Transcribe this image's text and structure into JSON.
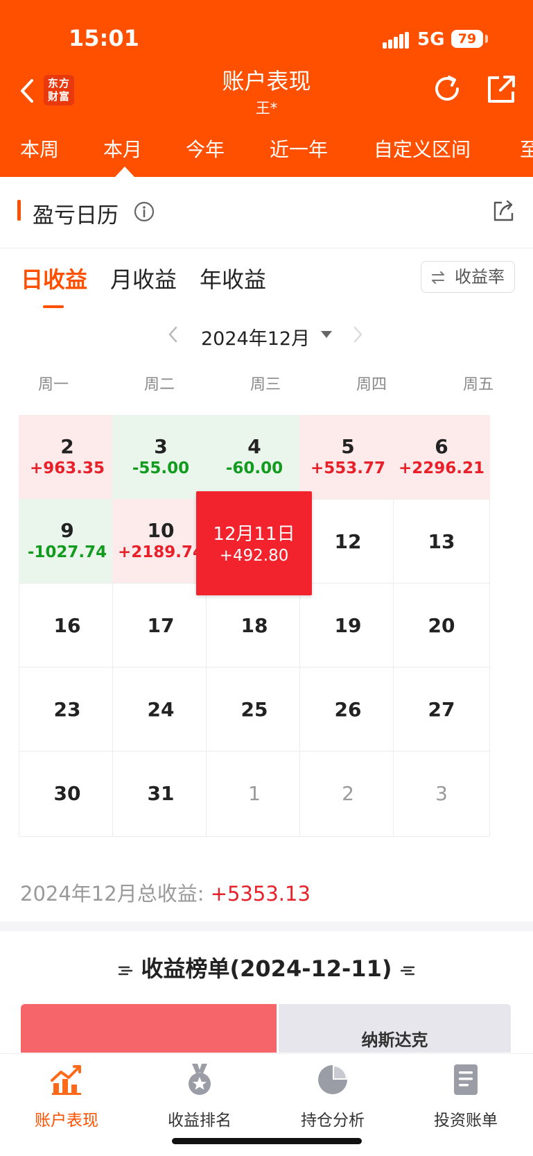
{
  "status_bar": {
    "time": "15:01",
    "network": "5G",
    "battery": "79"
  },
  "header": {
    "logo_line1": "东方",
    "logo_line2": "财富",
    "title": "账户表现",
    "subtitle": "王*"
  },
  "period_tabs": [
    "本周",
    "本月",
    "今年",
    "近一年",
    "自定义区间",
    "至"
  ],
  "period_active_index": 1,
  "calendar_section": {
    "title": "盈亏日历",
    "mode_tabs": [
      "日收益",
      "月收益",
      "年收益"
    ],
    "mode_active_index": 0,
    "rate_button": "收益率",
    "month_label": "2024年12月",
    "weekdays": [
      "周一",
      "周二",
      "周三",
      "周四",
      "周五"
    ],
    "rows": [
      [
        {
          "day": "2",
          "pnl": "+963.35",
          "status": "gain"
        },
        {
          "day": "3",
          "pnl": "-55.00",
          "status": "loss"
        },
        {
          "day": "4",
          "pnl": "-60.00",
          "status": "loss"
        },
        {
          "day": "5",
          "pnl": "+553.77",
          "status": "gain"
        },
        {
          "day": "6",
          "pnl": "+2296.21",
          "status": "gain"
        }
      ],
      [
        {
          "day": "9",
          "pnl": "-1027.74",
          "status": "loss"
        },
        {
          "day": "10",
          "pnl": "+2189.74",
          "status": "gain"
        },
        {
          "day": "12月11日",
          "pnl": "+492.80",
          "status": "selected"
        },
        {
          "day": "12",
          "pnl": "",
          "status": "plain"
        },
        {
          "day": "13",
          "pnl": "",
          "status": "plain"
        }
      ],
      [
        {
          "day": "16",
          "pnl": "",
          "status": "plain"
        },
        {
          "day": "17",
          "pnl": "",
          "status": "plain"
        },
        {
          "day": "18",
          "pnl": "",
          "status": "plain"
        },
        {
          "day": "19",
          "pnl": "",
          "status": "plain"
        },
        {
          "day": "20",
          "pnl": "",
          "status": "plain"
        }
      ],
      [
        {
          "day": "23",
          "pnl": "",
          "status": "plain"
        },
        {
          "day": "24",
          "pnl": "",
          "status": "plain"
        },
        {
          "day": "25",
          "pnl": "",
          "status": "plain"
        },
        {
          "day": "26",
          "pnl": "",
          "status": "plain"
        },
        {
          "day": "27",
          "pnl": "",
          "status": "plain"
        }
      ],
      [
        {
          "day": "30",
          "pnl": "",
          "status": "plain"
        },
        {
          "day": "31",
          "pnl": "",
          "status": "plain"
        },
        {
          "day": "1",
          "pnl": "",
          "status": "muted"
        },
        {
          "day": "2",
          "pnl": "",
          "status": "muted"
        },
        {
          "day": "3",
          "pnl": "",
          "status": "muted"
        }
      ]
    ],
    "total_label": "2024年12月总收益: ",
    "total_value": "+5353.13"
  },
  "ranking": {
    "title": "收益榜单(2024-12-11)",
    "benchmark_label": "纳斯达克"
  },
  "bottom_nav": [
    {
      "label": "账户表现",
      "icon": "trend-chart-icon"
    },
    {
      "label": "收益排名",
      "icon": "medal-icon"
    },
    {
      "label": "持仓分析",
      "icon": "pie-chart-icon"
    },
    {
      "label": "投资账单",
      "icon": "bill-document-icon"
    }
  ],
  "bottom_nav_active_index": 0,
  "colors": {
    "brand": "#FF5000",
    "gain_text": "#E8202A",
    "loss_text": "#129B1E",
    "gain_bg": "#FDEBEC",
    "loss_bg": "#EAF6EB",
    "selected_bg": "#F2232C"
  }
}
